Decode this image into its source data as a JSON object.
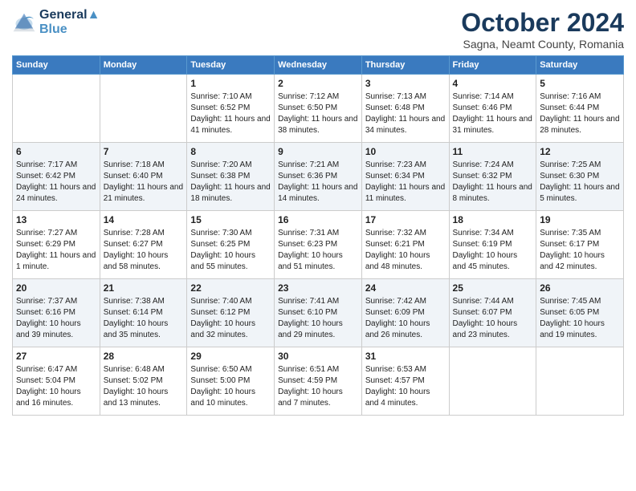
{
  "header": {
    "logo_line1": "General",
    "logo_line2": "Blue",
    "month_year": "October 2024",
    "location": "Sagna, Neamt County, Romania"
  },
  "weekdays": [
    "Sunday",
    "Monday",
    "Tuesday",
    "Wednesday",
    "Thursday",
    "Friday",
    "Saturday"
  ],
  "weeks": [
    [
      {
        "day": "",
        "info": ""
      },
      {
        "day": "",
        "info": ""
      },
      {
        "day": "1",
        "info": "Sunrise: 7:10 AM\nSunset: 6:52 PM\nDaylight: 11 hours and 41 minutes."
      },
      {
        "day": "2",
        "info": "Sunrise: 7:12 AM\nSunset: 6:50 PM\nDaylight: 11 hours and 38 minutes."
      },
      {
        "day": "3",
        "info": "Sunrise: 7:13 AM\nSunset: 6:48 PM\nDaylight: 11 hours and 34 minutes."
      },
      {
        "day": "4",
        "info": "Sunrise: 7:14 AM\nSunset: 6:46 PM\nDaylight: 11 hours and 31 minutes."
      },
      {
        "day": "5",
        "info": "Sunrise: 7:16 AM\nSunset: 6:44 PM\nDaylight: 11 hours and 28 minutes."
      }
    ],
    [
      {
        "day": "6",
        "info": "Sunrise: 7:17 AM\nSunset: 6:42 PM\nDaylight: 11 hours and 24 minutes."
      },
      {
        "day": "7",
        "info": "Sunrise: 7:18 AM\nSunset: 6:40 PM\nDaylight: 11 hours and 21 minutes."
      },
      {
        "day": "8",
        "info": "Sunrise: 7:20 AM\nSunset: 6:38 PM\nDaylight: 11 hours and 18 minutes."
      },
      {
        "day": "9",
        "info": "Sunrise: 7:21 AM\nSunset: 6:36 PM\nDaylight: 11 hours and 14 minutes."
      },
      {
        "day": "10",
        "info": "Sunrise: 7:23 AM\nSunset: 6:34 PM\nDaylight: 11 hours and 11 minutes."
      },
      {
        "day": "11",
        "info": "Sunrise: 7:24 AM\nSunset: 6:32 PM\nDaylight: 11 hours and 8 minutes."
      },
      {
        "day": "12",
        "info": "Sunrise: 7:25 AM\nSunset: 6:30 PM\nDaylight: 11 hours and 5 minutes."
      }
    ],
    [
      {
        "day": "13",
        "info": "Sunrise: 7:27 AM\nSunset: 6:29 PM\nDaylight: 11 hours and 1 minute."
      },
      {
        "day": "14",
        "info": "Sunrise: 7:28 AM\nSunset: 6:27 PM\nDaylight: 10 hours and 58 minutes."
      },
      {
        "day": "15",
        "info": "Sunrise: 7:30 AM\nSunset: 6:25 PM\nDaylight: 10 hours and 55 minutes."
      },
      {
        "day": "16",
        "info": "Sunrise: 7:31 AM\nSunset: 6:23 PM\nDaylight: 10 hours and 51 minutes."
      },
      {
        "day": "17",
        "info": "Sunrise: 7:32 AM\nSunset: 6:21 PM\nDaylight: 10 hours and 48 minutes."
      },
      {
        "day": "18",
        "info": "Sunrise: 7:34 AM\nSunset: 6:19 PM\nDaylight: 10 hours and 45 minutes."
      },
      {
        "day": "19",
        "info": "Sunrise: 7:35 AM\nSunset: 6:17 PM\nDaylight: 10 hours and 42 minutes."
      }
    ],
    [
      {
        "day": "20",
        "info": "Sunrise: 7:37 AM\nSunset: 6:16 PM\nDaylight: 10 hours and 39 minutes."
      },
      {
        "day": "21",
        "info": "Sunrise: 7:38 AM\nSunset: 6:14 PM\nDaylight: 10 hours and 35 minutes."
      },
      {
        "day": "22",
        "info": "Sunrise: 7:40 AM\nSunset: 6:12 PM\nDaylight: 10 hours and 32 minutes."
      },
      {
        "day": "23",
        "info": "Sunrise: 7:41 AM\nSunset: 6:10 PM\nDaylight: 10 hours and 29 minutes."
      },
      {
        "day": "24",
        "info": "Sunrise: 7:42 AM\nSunset: 6:09 PM\nDaylight: 10 hours and 26 minutes."
      },
      {
        "day": "25",
        "info": "Sunrise: 7:44 AM\nSunset: 6:07 PM\nDaylight: 10 hours and 23 minutes."
      },
      {
        "day": "26",
        "info": "Sunrise: 7:45 AM\nSunset: 6:05 PM\nDaylight: 10 hours and 19 minutes."
      }
    ],
    [
      {
        "day": "27",
        "info": "Sunrise: 6:47 AM\nSunset: 5:04 PM\nDaylight: 10 hours and 16 minutes."
      },
      {
        "day": "28",
        "info": "Sunrise: 6:48 AM\nSunset: 5:02 PM\nDaylight: 10 hours and 13 minutes."
      },
      {
        "day": "29",
        "info": "Sunrise: 6:50 AM\nSunset: 5:00 PM\nDaylight: 10 hours and 10 minutes."
      },
      {
        "day": "30",
        "info": "Sunrise: 6:51 AM\nSunset: 4:59 PM\nDaylight: 10 hours and 7 minutes."
      },
      {
        "day": "31",
        "info": "Sunrise: 6:53 AM\nSunset: 4:57 PM\nDaylight: 10 hours and 4 minutes."
      },
      {
        "day": "",
        "info": ""
      },
      {
        "day": "",
        "info": ""
      }
    ]
  ]
}
